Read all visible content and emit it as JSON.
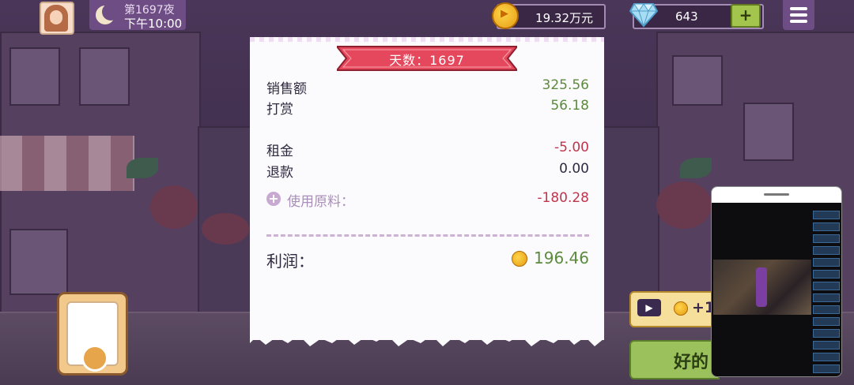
{
  "hud": {
    "night_label": "第1697夜",
    "time_label": "下午10:00",
    "coins": "19.32万元",
    "gems": "643",
    "add_label": "+"
  },
  "receipt": {
    "title": "天数：1697",
    "rows": [
      {
        "label": "销售额",
        "value": "325.56"
      },
      {
        "label": "打赏",
        "value": "56.18"
      },
      {
        "label": "租金",
        "value": "-5.00"
      },
      {
        "label": "退款",
        "value": "0.00"
      },
      {
        "label": "使用原料：",
        "value": "-180.28"
      }
    ],
    "profit_label": "利润：",
    "profit_value": "196.46"
  },
  "buttons": {
    "ad_reward": "+1",
    "ok": "好的"
  },
  "colors": {
    "positive": "#5c8a3e",
    "negative": "#c0354c",
    "ribbon": "#e5485c",
    "hud_panel": "#6e4d84"
  },
  "icons": [
    "avatar",
    "moon-icon",
    "coin-icon",
    "diamond-icon",
    "menu-icon",
    "plus-circle-icon",
    "play-video-icon"
  ]
}
